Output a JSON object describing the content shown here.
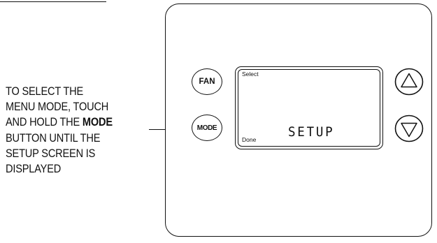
{
  "instruction": {
    "line1": "TO SELECT THE",
    "line2": "MENU MODE, TOUCH",
    "line3_prefix": "AND HOLD THE ",
    "line3_bold": "MODE",
    "line4": "BUTTON UNTIL THE",
    "line5": "SETUP SCREEN IS",
    "line6": "DISPLAYED"
  },
  "device": {
    "buttons": {
      "fan_label": "FAN",
      "mode_label": "MODE",
      "up_icon": "triangle-up-icon",
      "down_icon": "triangle-down-icon"
    },
    "screen": {
      "top_left_label": "Select",
      "bottom_left_label": "Done",
      "display_text": "SETUP"
    }
  },
  "colors": {
    "line": "#111111",
    "background": "#ffffff"
  }
}
